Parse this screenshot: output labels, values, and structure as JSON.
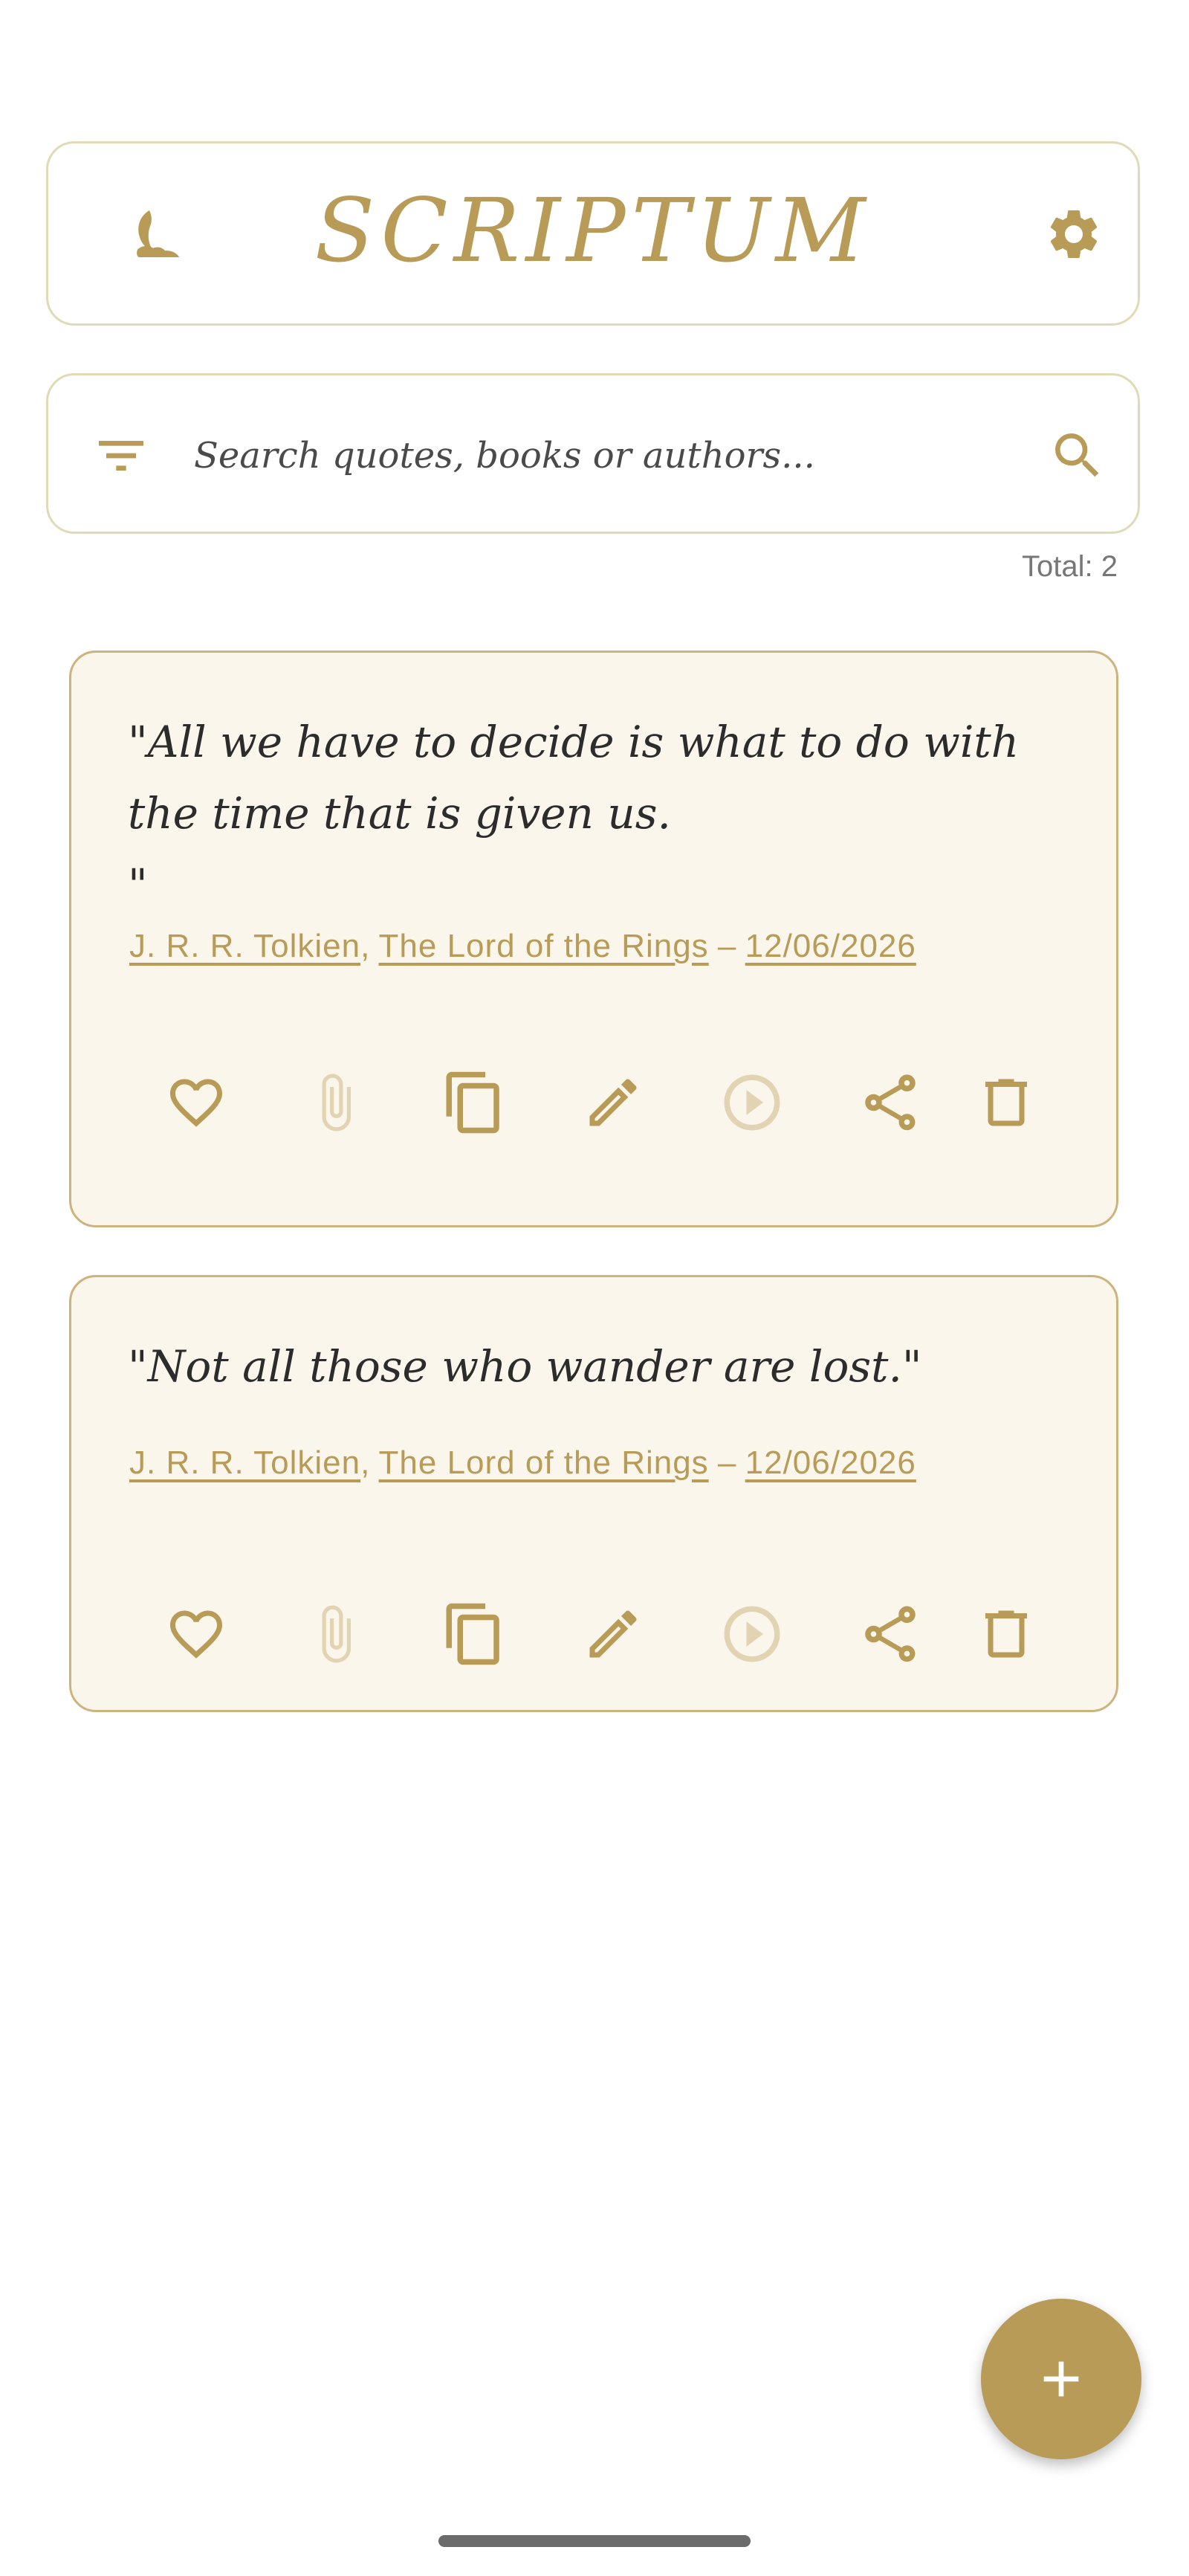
{
  "colors": {
    "accent": "#b89b57",
    "accent_light": "#e2d9b7",
    "card_bg": "#fbf6ec",
    "card_border": "#cdb37e"
  },
  "header": {
    "title": "SCRIPTUM",
    "left_icon": "moon-icon",
    "right_icon": "gear-icon"
  },
  "search": {
    "placeholder": "Search quotes, books or authors...",
    "value": "",
    "left_icon": "filter-icon",
    "right_icon": "search-icon"
  },
  "total_label": "Total: 2",
  "quotes": [
    {
      "text": "\"All we have to decide is what to do with the time that is given us.\n\"",
      "author": "J. R. R. Tolkien",
      "book": "The Lord of the Rings",
      "date": "12/06/2026",
      "comma": ",",
      "dash": "–"
    },
    {
      "text": "\"Not all those who wander are lost.\"",
      "author": "J. R. R. Tolkien",
      "book": "The Lord of the Rings",
      "date": "12/06/2026",
      "comma": ",",
      "dash": "–"
    }
  ],
  "card_actions": [
    "heart-icon",
    "paperclip-icon",
    "copy-icon",
    "pencil-icon",
    "play-icon",
    "share-icon",
    "trash-icon"
  ],
  "fab": {
    "label": "+",
    "icon": "plus-icon"
  }
}
